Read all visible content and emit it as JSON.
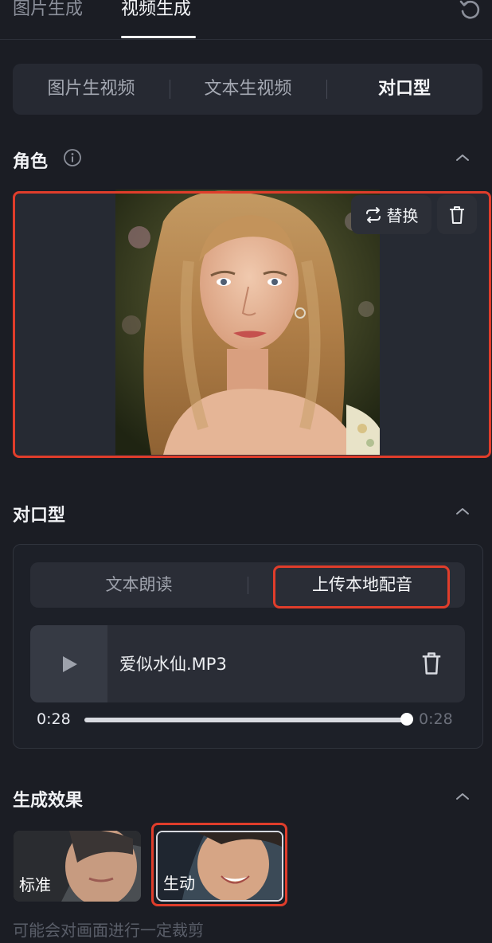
{
  "top_tabs": [
    {
      "label": "图片生成",
      "active": false
    },
    {
      "label": "视频生成",
      "active": true
    }
  ],
  "icons": {
    "refresh": "refresh-icon",
    "info": "info-icon",
    "collapse": "chevron-up-icon",
    "swap": "swap-icon",
    "trash": "trash-icon",
    "play": "play-icon"
  },
  "mode_tabs": [
    {
      "label": "图片生视频",
      "active": false
    },
    {
      "label": "文本生视频",
      "active": false
    },
    {
      "label": "对口型",
      "active": true
    }
  ],
  "character": {
    "title": "角色",
    "replace_label": "替换"
  },
  "lip_sync": {
    "title": "对口型",
    "tabs": [
      {
        "label": "文本朗读",
        "active": false
      },
      {
        "label": "上传本地配音",
        "active": true
      }
    ],
    "file_name": "爱似水仙.MP3",
    "current_time": "0:28",
    "total_time": "0:28",
    "progress": 1.0
  },
  "effect": {
    "title": "生成效果",
    "options": [
      {
        "label": "标准",
        "selected": false
      },
      {
        "label": "生动",
        "selected": true
      }
    ],
    "hint": "可能会对画面进行一定裁剪"
  },
  "colors": {
    "background": "#1b1d24",
    "highlight": "#e03d2b"
  }
}
